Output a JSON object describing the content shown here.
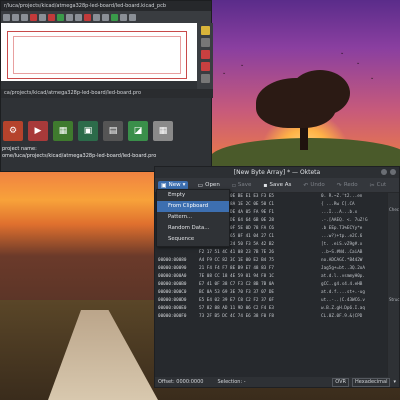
{
  "kicad": {
    "title": "r/luca/projects/kicad/atmega328p-led-board/led-board.kicad_pcb",
    "path_bar": "ca/projects/kicad/atmega328p-led-board/led-board.pro",
    "project_label": "project name:",
    "project_path": "ome/luca/projects/kicad/atmega328p-led-board/led-board.pro"
  },
  "okteta": {
    "title": "[New Byte Array] * — Okteta",
    "toolbar": {
      "new": "New",
      "open": "Open",
      "save": "Save",
      "save_as": "Save As",
      "undo": "Undo",
      "redo": "Redo",
      "cut": "Cut"
    },
    "new_menu": [
      "Empty",
      "From Clipboard",
      "Pattern...",
      "Random Data...",
      "Sequence"
    ],
    "hex_rows": [
      {
        "offset": "",
        "bytes": "B6 B0 BE 5A 0E BE  E1 E3 F3 E5",
        "chars": "0. R.~Z.'t2...en"
      },
      {
        "offset": "",
        "bytes": "8F 8A 49 A7 8A 1E  2C 0E 50 C1",
        "chars": "{  ...Rw C[.CA"
      },
      {
        "offset": "",
        "bytes": "18 A2 FB C0 DE 4A  05 FA 9E F1",
        "chars": "...I...A...b.x"
      },
      {
        "offset": "",
        "bytes": "2B 88 50 60 DE 64  64 6B 0E 28",
        "chars": ".-.[AAEQ. <. 7uZ!G"
      },
      {
        "offset": "",
        "bytes": "6E CC 33 46 0F 5E  0D 78 FA C6",
        "chars": ".b EEp.T3%ECYy*e"
      },
      {
        "offset": "",
        "bytes": "B5 A3 4C 42 65 0F  41 04 27 C1",
        "chars": "...w?)+tp..e2C.6"
      },
      {
        "offset": "",
        "bytes": "50 0F 80 00 24 50  F3 5A 42 B2",
        "chars": "[t.  .eiS.vZ9g#.x"
      },
      {
        "offset": "",
        "bytes": "F2 17 51 4C 41 08  23 7B 7E 26",
        "chars": "..b~S.#N4..CaiAB"
      },
      {
        "offset": "00000:00080",
        "bytes": "A4 F9 CC 82 3C 1E  00 E2 B4 75",
        "chars": "no.ADCAGC.*B442W"
      },
      {
        "offset": "00000:00090",
        "bytes": "21 F4 F4 F7 8E B9  E7 48 83 F7",
        "chars": "Jag5g+=bt..3Q.2oA"
      },
      {
        "offset": "00000:000A0",
        "bytes": "7E 08 CC 18 4E 59  01 94 F8 1C",
        "chars": "at.d.l..vsmmyH0p."
      },
      {
        "offset": "00000:000B0",
        "bytes": "E7 41 0F 38 C7 F3  C2 8B 7B 0A",
        "chars": "gCC..g4.s4.4.eHB"
      },
      {
        "offset": "00000:000C0",
        "bytes": "BC 0A 53 69 3E 70  F3 37 07 DE",
        "chars": "at.d.f....st+.-ug"
      },
      {
        "offset": "00000:000D0",
        "bytes": "E5 E4 02 39 E7 C8  C2 F2 37 6F",
        "chars": "ut..-..(C.43WC6.v"
      },
      {
        "offset": "00000:000E0",
        "bytes": "57 82 88 AD 11 9D  06 C2 F4 E3",
        "chars": "w.B.Z.gH.Dp6.I.aq"
      },
      {
        "offset": "00000:000F0",
        "bytes": "73 2F B5 DC 4C 74  E6 38 F0 F8",
        "chars": "CL.0Z.0F.9.&(CPD"
      }
    ],
    "status": {
      "offset": "Offset: 0000:0000",
      "selection": "Selection: -",
      "ovr": "OVR",
      "encoding": "Hexadecimal"
    },
    "sidebar_labels": [
      "Chec",
      "Struc"
    ]
  },
  "colors": {
    "accent": "#3d6fb0",
    "window_bg": "#3b3f44",
    "hex_bg": "#26292d"
  }
}
